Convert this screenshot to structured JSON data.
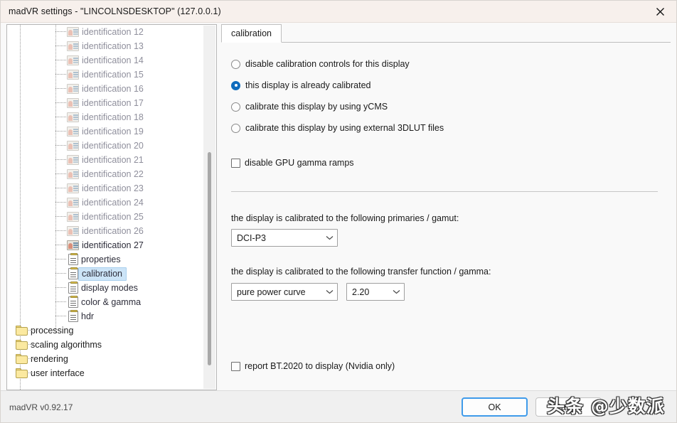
{
  "window": {
    "title": "madVR settings - \"LINCOLNSDESKTOP\" (127.0.0.1)",
    "close_label": "✕"
  },
  "tree": {
    "identification_items": [
      {
        "label": "identification 12",
        "dim": true
      },
      {
        "label": "identification 13",
        "dim": true
      },
      {
        "label": "identification 14",
        "dim": true
      },
      {
        "label": "identification 15",
        "dim": true
      },
      {
        "label": "identification 16",
        "dim": true
      },
      {
        "label": "identification 17",
        "dim": true
      },
      {
        "label": "identification 18",
        "dim": true
      },
      {
        "label": "identification 19",
        "dim": true
      },
      {
        "label": "identification 20",
        "dim": true
      },
      {
        "label": "identification 21",
        "dim": true
      },
      {
        "label": "identification 22",
        "dim": true
      },
      {
        "label": "identification 23",
        "dim": true
      },
      {
        "label": "identification 24",
        "dim": true
      },
      {
        "label": "identification 25",
        "dim": true
      },
      {
        "label": "identification 26",
        "dim": true
      },
      {
        "label": "identification 27",
        "dim": false
      }
    ],
    "page_items": [
      {
        "label": "properties",
        "selected": false
      },
      {
        "label": "calibration",
        "selected": true
      },
      {
        "label": "display modes",
        "selected": false
      },
      {
        "label": "color & gamma",
        "selected": false
      },
      {
        "label": "hdr",
        "selected": false
      }
    ],
    "folder_items": [
      {
        "label": "processing"
      },
      {
        "label": "scaling algorithms"
      },
      {
        "label": "rendering"
      },
      {
        "label": "user interface"
      }
    ]
  },
  "content": {
    "tab_label": "calibration",
    "radio_options": [
      {
        "label": "disable calibration controls for this display",
        "checked": false
      },
      {
        "label": "this display is already calibrated",
        "checked": true
      },
      {
        "label": "calibrate this display by using yCMS",
        "checked": false
      },
      {
        "label": "calibrate this display by using external 3DLUT files",
        "checked": false
      }
    ],
    "gpu_gamma_checkbox": {
      "label": "disable GPU gamma ramps",
      "checked": false
    },
    "primaries_label": "the display is calibrated to the following primaries / gamut:",
    "primaries_value": "DCI-P3",
    "transfer_label": "the display is calibrated to the following transfer function / gamma:",
    "transfer_value": "pure power curve",
    "gamma_value": "2.20",
    "bt2020_checkbox": {
      "label": "report BT.2020 to display  (Nvidia only)",
      "checked": false
    }
  },
  "footer": {
    "version": "madVR v0.92.17",
    "ok_label": "OK",
    "cancel_label": "Cancel"
  },
  "watermark": {
    "text": "头条 @少数派"
  },
  "colors": {
    "titlebar_bg": "#f7f0ec",
    "panel_bg": "#f9f9f9",
    "accent_blue": "#0f6cbd",
    "selection_blue": "#cce4f7",
    "folder_yellow": "#fbe9a0"
  }
}
